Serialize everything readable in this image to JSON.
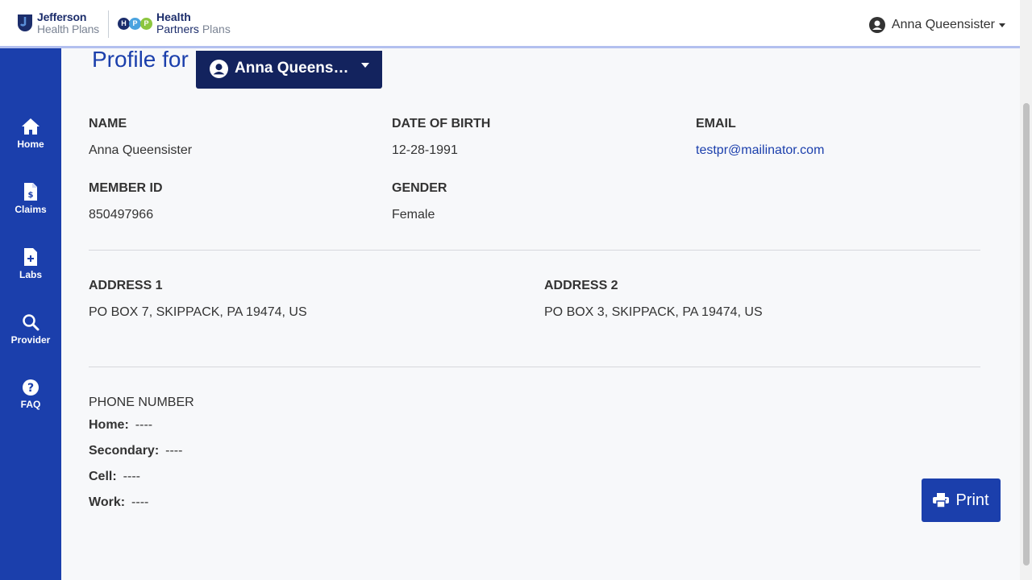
{
  "header": {
    "jefferson_logo": {
      "line1": "Jefferson",
      "line2": "Health Plans"
    },
    "hpp_logo": {
      "circles": [
        "H",
        "P",
        "P"
      ],
      "line1": "Health",
      "line2a": "Partners",
      "line2b": "Plans"
    },
    "user_name": "Anna Queensister"
  },
  "sidebar": {
    "items": [
      {
        "label": "Home",
        "icon": "home-icon"
      },
      {
        "label": "Claims",
        "icon": "claims-icon"
      },
      {
        "label": "Labs",
        "icon": "labs-icon"
      },
      {
        "label": "Provider",
        "icon": "search-icon"
      },
      {
        "label": "FAQ",
        "icon": "question-icon"
      }
    ]
  },
  "profile": {
    "title": "Profile for",
    "selected_member": "Anna Queensister",
    "name_label": "NAME",
    "name_value": "Anna Queensister",
    "dob_label": "DATE OF BIRTH",
    "dob_value": "12-28-1991",
    "email_label": "EMAIL",
    "email_value": "testpr@mailinator.com",
    "member_id_label": "MEMBER ID",
    "member_id_value": "850497966",
    "gender_label": "GENDER",
    "gender_value": "Female",
    "address1_label": "ADDRESS 1",
    "address1_value": "PO BOX 7, SKIPPACK, PA 19474, US",
    "address2_label": "ADDRESS 2",
    "address2_value": "PO BOX 3, SKIPPACK, PA 19474, US"
  },
  "phone": {
    "title": "PHONE NUMBER",
    "home_label": "Home:",
    "home_value": "----",
    "secondary_label": "Secondary:",
    "secondary_value": "----",
    "cell_label": "Cell:",
    "cell_value": "----",
    "work_label": "Work:",
    "work_value": "----"
  },
  "actions": {
    "print_label": "Print"
  },
  "colors": {
    "brand_blue": "#1b3fac",
    "navy": "#13235e",
    "link": "#1b3fac"
  }
}
